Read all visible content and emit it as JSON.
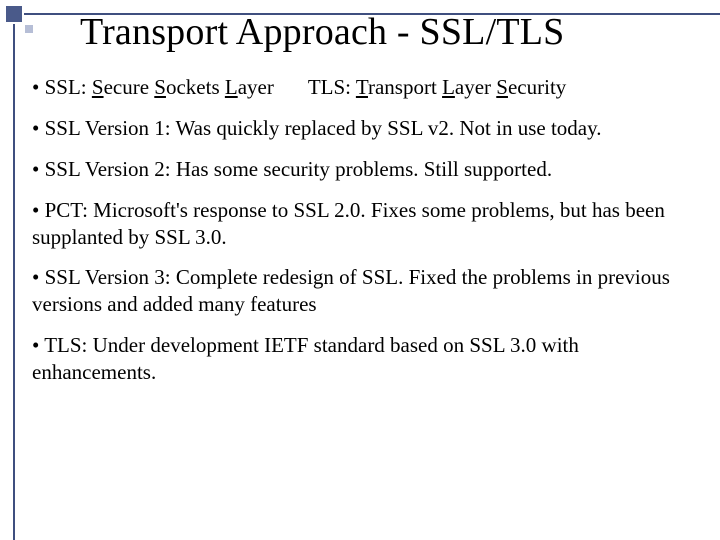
{
  "title": "Transport Approach - SSL/TLS",
  "defs": {
    "ssl": {
      "prefix": "• SSL: ",
      "p1_u": "S",
      "p1": "ecure ",
      "p2_u": "S",
      "p2": "ockets ",
      "p3_u": "L",
      "p3": "ayer"
    },
    "tls": {
      "prefix": "TLS: ",
      "p1_u": "T",
      "p1": "ransport ",
      "p2_u": "L",
      "p2": "ayer ",
      "p3_u": "S",
      "p3": "ecurity"
    }
  },
  "bullets": {
    "b1": "• SSL Version 1: Was quickly replaced by SSL v2. Not in use today.",
    "b2": "• SSL Version 2: Has some security problems. Still supported.",
    "b3": "• PCT: Microsoft's response to SSL 2.0. Fixes some problems, but has been supplanted by SSL 3.0.",
    "b4": "• SSL Version 3: Complete redesign of SSL. Fixed the problems in previous versions and added many features",
    "b5": "• TLS: Under development IETF standard based on SSL 3.0 with enhancements."
  }
}
